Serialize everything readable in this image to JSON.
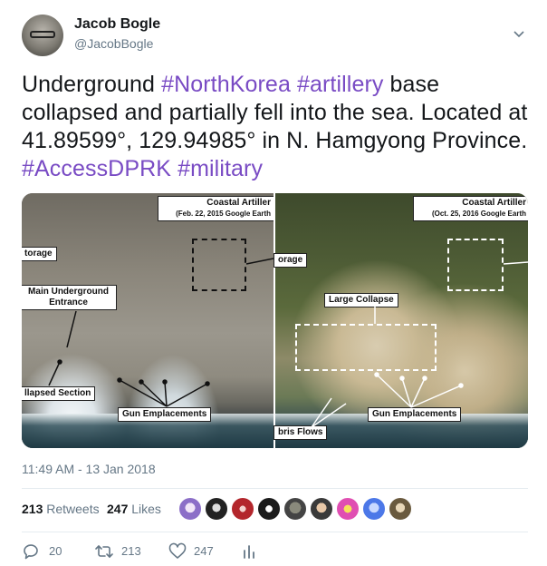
{
  "author": {
    "name": "Jacob Bogle",
    "handle": "@JacobBogle"
  },
  "tweet": {
    "line1_prefix": "Underground ",
    "tag_northkorea": "#NorthKorea",
    "line1_space": " ",
    "tag_artillery": "#artillery",
    "line1_suffix": " base collapsed and partially fell into the sea. Located at 41.89599°, 129.94985° in N. Hamgyong Province. ",
    "tag_accessdprk": "#AccessDPRK",
    "line_space2": " ",
    "tag_military": "#military",
    "hashtag_color": "#794bc4"
  },
  "image": {
    "left": {
      "title": "Coastal Artiller",
      "date": "(Feb. 22, 2015 Google Earth",
      "storage": "torage",
      "main_entrance_1": "Main Underground",
      "main_entrance_2": "Entrance",
      "collapsed_section": "llapsed Section",
      "gun_emplacements": "Gun Emplacements"
    },
    "right": {
      "title": "Coastal Artiller",
      "date": "(Oct. 25, 2016 Google Earth",
      "storage": "orage",
      "large_collapse": "Large Collapse",
      "debris_flows": "bris Flows",
      "gun_emplacements": "Gun Emplacements"
    }
  },
  "timestamp": "11:49 AM - 13 Jan 2018",
  "stats": {
    "retweets_count": "213",
    "retweets_label": "Retweets",
    "likes_count": "247",
    "likes_label": "Likes"
  },
  "actions": {
    "reply_count": "20",
    "retweet_count": "213",
    "like_count": "247"
  },
  "colors": {
    "text_secondary": "#657786",
    "hashtag": "#794bc4"
  }
}
